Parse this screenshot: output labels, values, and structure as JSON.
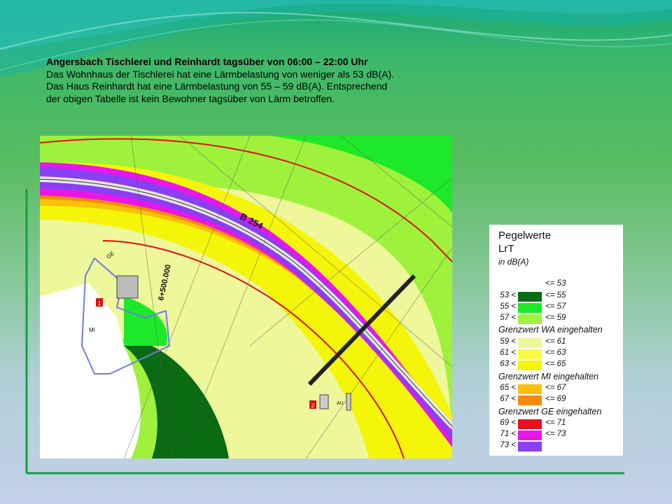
{
  "caption": {
    "title": "Angersbach Tischlerei und Reinhardt tagsüber von 06:00 – 22:00 Uhr",
    "line1": "Das Wohnhaus der Tischlerei hat eine Lärmbelastung von weniger als 53 dB(A).",
    "line2": "Das Haus Reinhardt hat eine Lärmbelastung von 55 – 59 dB(A). Entsprechend",
    "line3": "der obigen Tabelle ist kein Bewohner tagsüber von Lärm betroffen."
  },
  "map": {
    "road_label": "B 254",
    "station_label": "6+500.000",
    "zone_ge": "GE",
    "zone_mi": "MI",
    "zone_au": "AU",
    "house_marker_1": "1",
    "house_marker_2": "2"
  },
  "legend": {
    "title_1": "Pegelwerte",
    "title_2": "LrT",
    "unit": "in dB(A)",
    "rows": [
      {
        "lo": "",
        "hi": "<= 53",
        "color": "#ffffff"
      },
      {
        "lo": "53 <",
        "hi": "<= 55",
        "color": "#0a6b12"
      },
      {
        "lo": "55 <",
        "hi": "<= 57",
        "color": "#1ee82a"
      },
      {
        "lo": "57 <",
        "hi": "<= 59",
        "color": "#9ef23c"
      },
      {
        "lo": "59 <",
        "hi": "<= 61",
        "color": "#eef79a"
      },
      {
        "lo": "61 <",
        "hi": "<= 63",
        "color": "#fafa4a"
      },
      {
        "lo": "63 <",
        "hi": "<= 65",
        "color": "#f5f50a"
      },
      {
        "lo": "65 <",
        "hi": "<= 67",
        "color": "#f9c10a"
      },
      {
        "lo": "67 <",
        "hi": "<= 69",
        "color": "#f58a0c"
      },
      {
        "lo": "69 <",
        "hi": "<= 71",
        "color": "#e8101c"
      },
      {
        "lo": "71 <",
        "hi": "<= 73",
        "color": "#e816e8"
      },
      {
        "lo": "73 <",
        "hi": "",
        "color": "#8a3ff2"
      }
    ],
    "group_wa": "Grenzwert WA eingehalten",
    "group_mi": "Grenzwert MI eingehalten",
    "group_ge": "Grenzwert GE eingehalten"
  }
}
